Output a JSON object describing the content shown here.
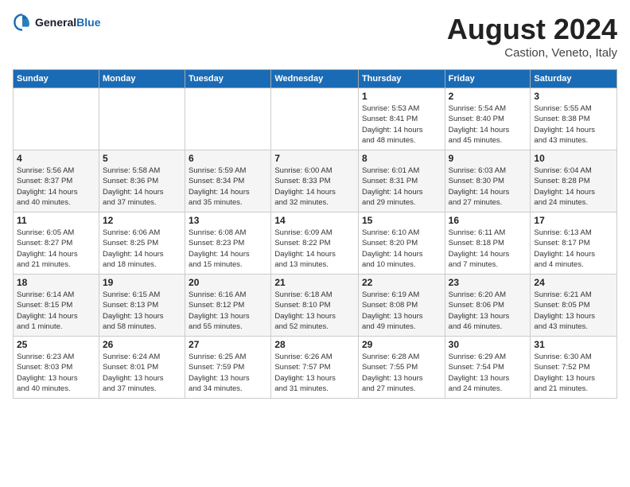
{
  "header": {
    "logo_line1": "General",
    "logo_line2": "Blue",
    "month": "August 2024",
    "location": "Castion, Veneto, Italy"
  },
  "days_of_week": [
    "Sunday",
    "Monday",
    "Tuesday",
    "Wednesday",
    "Thursday",
    "Friday",
    "Saturday"
  ],
  "weeks": [
    [
      {
        "day": "",
        "info": ""
      },
      {
        "day": "",
        "info": ""
      },
      {
        "day": "",
        "info": ""
      },
      {
        "day": "",
        "info": ""
      },
      {
        "day": "1",
        "info": "Sunrise: 5:53 AM\nSunset: 8:41 PM\nDaylight: 14 hours\nand 48 minutes."
      },
      {
        "day": "2",
        "info": "Sunrise: 5:54 AM\nSunset: 8:40 PM\nDaylight: 14 hours\nand 45 minutes."
      },
      {
        "day": "3",
        "info": "Sunrise: 5:55 AM\nSunset: 8:38 PM\nDaylight: 14 hours\nand 43 minutes."
      }
    ],
    [
      {
        "day": "4",
        "info": "Sunrise: 5:56 AM\nSunset: 8:37 PM\nDaylight: 14 hours\nand 40 minutes."
      },
      {
        "day": "5",
        "info": "Sunrise: 5:58 AM\nSunset: 8:36 PM\nDaylight: 14 hours\nand 37 minutes."
      },
      {
        "day": "6",
        "info": "Sunrise: 5:59 AM\nSunset: 8:34 PM\nDaylight: 14 hours\nand 35 minutes."
      },
      {
        "day": "7",
        "info": "Sunrise: 6:00 AM\nSunset: 8:33 PM\nDaylight: 14 hours\nand 32 minutes."
      },
      {
        "day": "8",
        "info": "Sunrise: 6:01 AM\nSunset: 8:31 PM\nDaylight: 14 hours\nand 29 minutes."
      },
      {
        "day": "9",
        "info": "Sunrise: 6:03 AM\nSunset: 8:30 PM\nDaylight: 14 hours\nand 27 minutes."
      },
      {
        "day": "10",
        "info": "Sunrise: 6:04 AM\nSunset: 8:28 PM\nDaylight: 14 hours\nand 24 minutes."
      }
    ],
    [
      {
        "day": "11",
        "info": "Sunrise: 6:05 AM\nSunset: 8:27 PM\nDaylight: 14 hours\nand 21 minutes."
      },
      {
        "day": "12",
        "info": "Sunrise: 6:06 AM\nSunset: 8:25 PM\nDaylight: 14 hours\nand 18 minutes."
      },
      {
        "day": "13",
        "info": "Sunrise: 6:08 AM\nSunset: 8:23 PM\nDaylight: 14 hours\nand 15 minutes."
      },
      {
        "day": "14",
        "info": "Sunrise: 6:09 AM\nSunset: 8:22 PM\nDaylight: 14 hours\nand 13 minutes."
      },
      {
        "day": "15",
        "info": "Sunrise: 6:10 AM\nSunset: 8:20 PM\nDaylight: 14 hours\nand 10 minutes."
      },
      {
        "day": "16",
        "info": "Sunrise: 6:11 AM\nSunset: 8:18 PM\nDaylight: 14 hours\nand 7 minutes."
      },
      {
        "day": "17",
        "info": "Sunrise: 6:13 AM\nSunset: 8:17 PM\nDaylight: 14 hours\nand 4 minutes."
      }
    ],
    [
      {
        "day": "18",
        "info": "Sunrise: 6:14 AM\nSunset: 8:15 PM\nDaylight: 14 hours\nand 1 minute."
      },
      {
        "day": "19",
        "info": "Sunrise: 6:15 AM\nSunset: 8:13 PM\nDaylight: 13 hours\nand 58 minutes."
      },
      {
        "day": "20",
        "info": "Sunrise: 6:16 AM\nSunset: 8:12 PM\nDaylight: 13 hours\nand 55 minutes."
      },
      {
        "day": "21",
        "info": "Sunrise: 6:18 AM\nSunset: 8:10 PM\nDaylight: 13 hours\nand 52 minutes."
      },
      {
        "day": "22",
        "info": "Sunrise: 6:19 AM\nSunset: 8:08 PM\nDaylight: 13 hours\nand 49 minutes."
      },
      {
        "day": "23",
        "info": "Sunrise: 6:20 AM\nSunset: 8:06 PM\nDaylight: 13 hours\nand 46 minutes."
      },
      {
        "day": "24",
        "info": "Sunrise: 6:21 AM\nSunset: 8:05 PM\nDaylight: 13 hours\nand 43 minutes."
      }
    ],
    [
      {
        "day": "25",
        "info": "Sunrise: 6:23 AM\nSunset: 8:03 PM\nDaylight: 13 hours\nand 40 minutes."
      },
      {
        "day": "26",
        "info": "Sunrise: 6:24 AM\nSunset: 8:01 PM\nDaylight: 13 hours\nand 37 minutes."
      },
      {
        "day": "27",
        "info": "Sunrise: 6:25 AM\nSunset: 7:59 PM\nDaylight: 13 hours\nand 34 minutes."
      },
      {
        "day": "28",
        "info": "Sunrise: 6:26 AM\nSunset: 7:57 PM\nDaylight: 13 hours\nand 31 minutes."
      },
      {
        "day": "29",
        "info": "Sunrise: 6:28 AM\nSunset: 7:55 PM\nDaylight: 13 hours\nand 27 minutes."
      },
      {
        "day": "30",
        "info": "Sunrise: 6:29 AM\nSunset: 7:54 PM\nDaylight: 13 hours\nand 24 minutes."
      },
      {
        "day": "31",
        "info": "Sunrise: 6:30 AM\nSunset: 7:52 PM\nDaylight: 13 hours\nand 21 minutes."
      }
    ]
  ]
}
